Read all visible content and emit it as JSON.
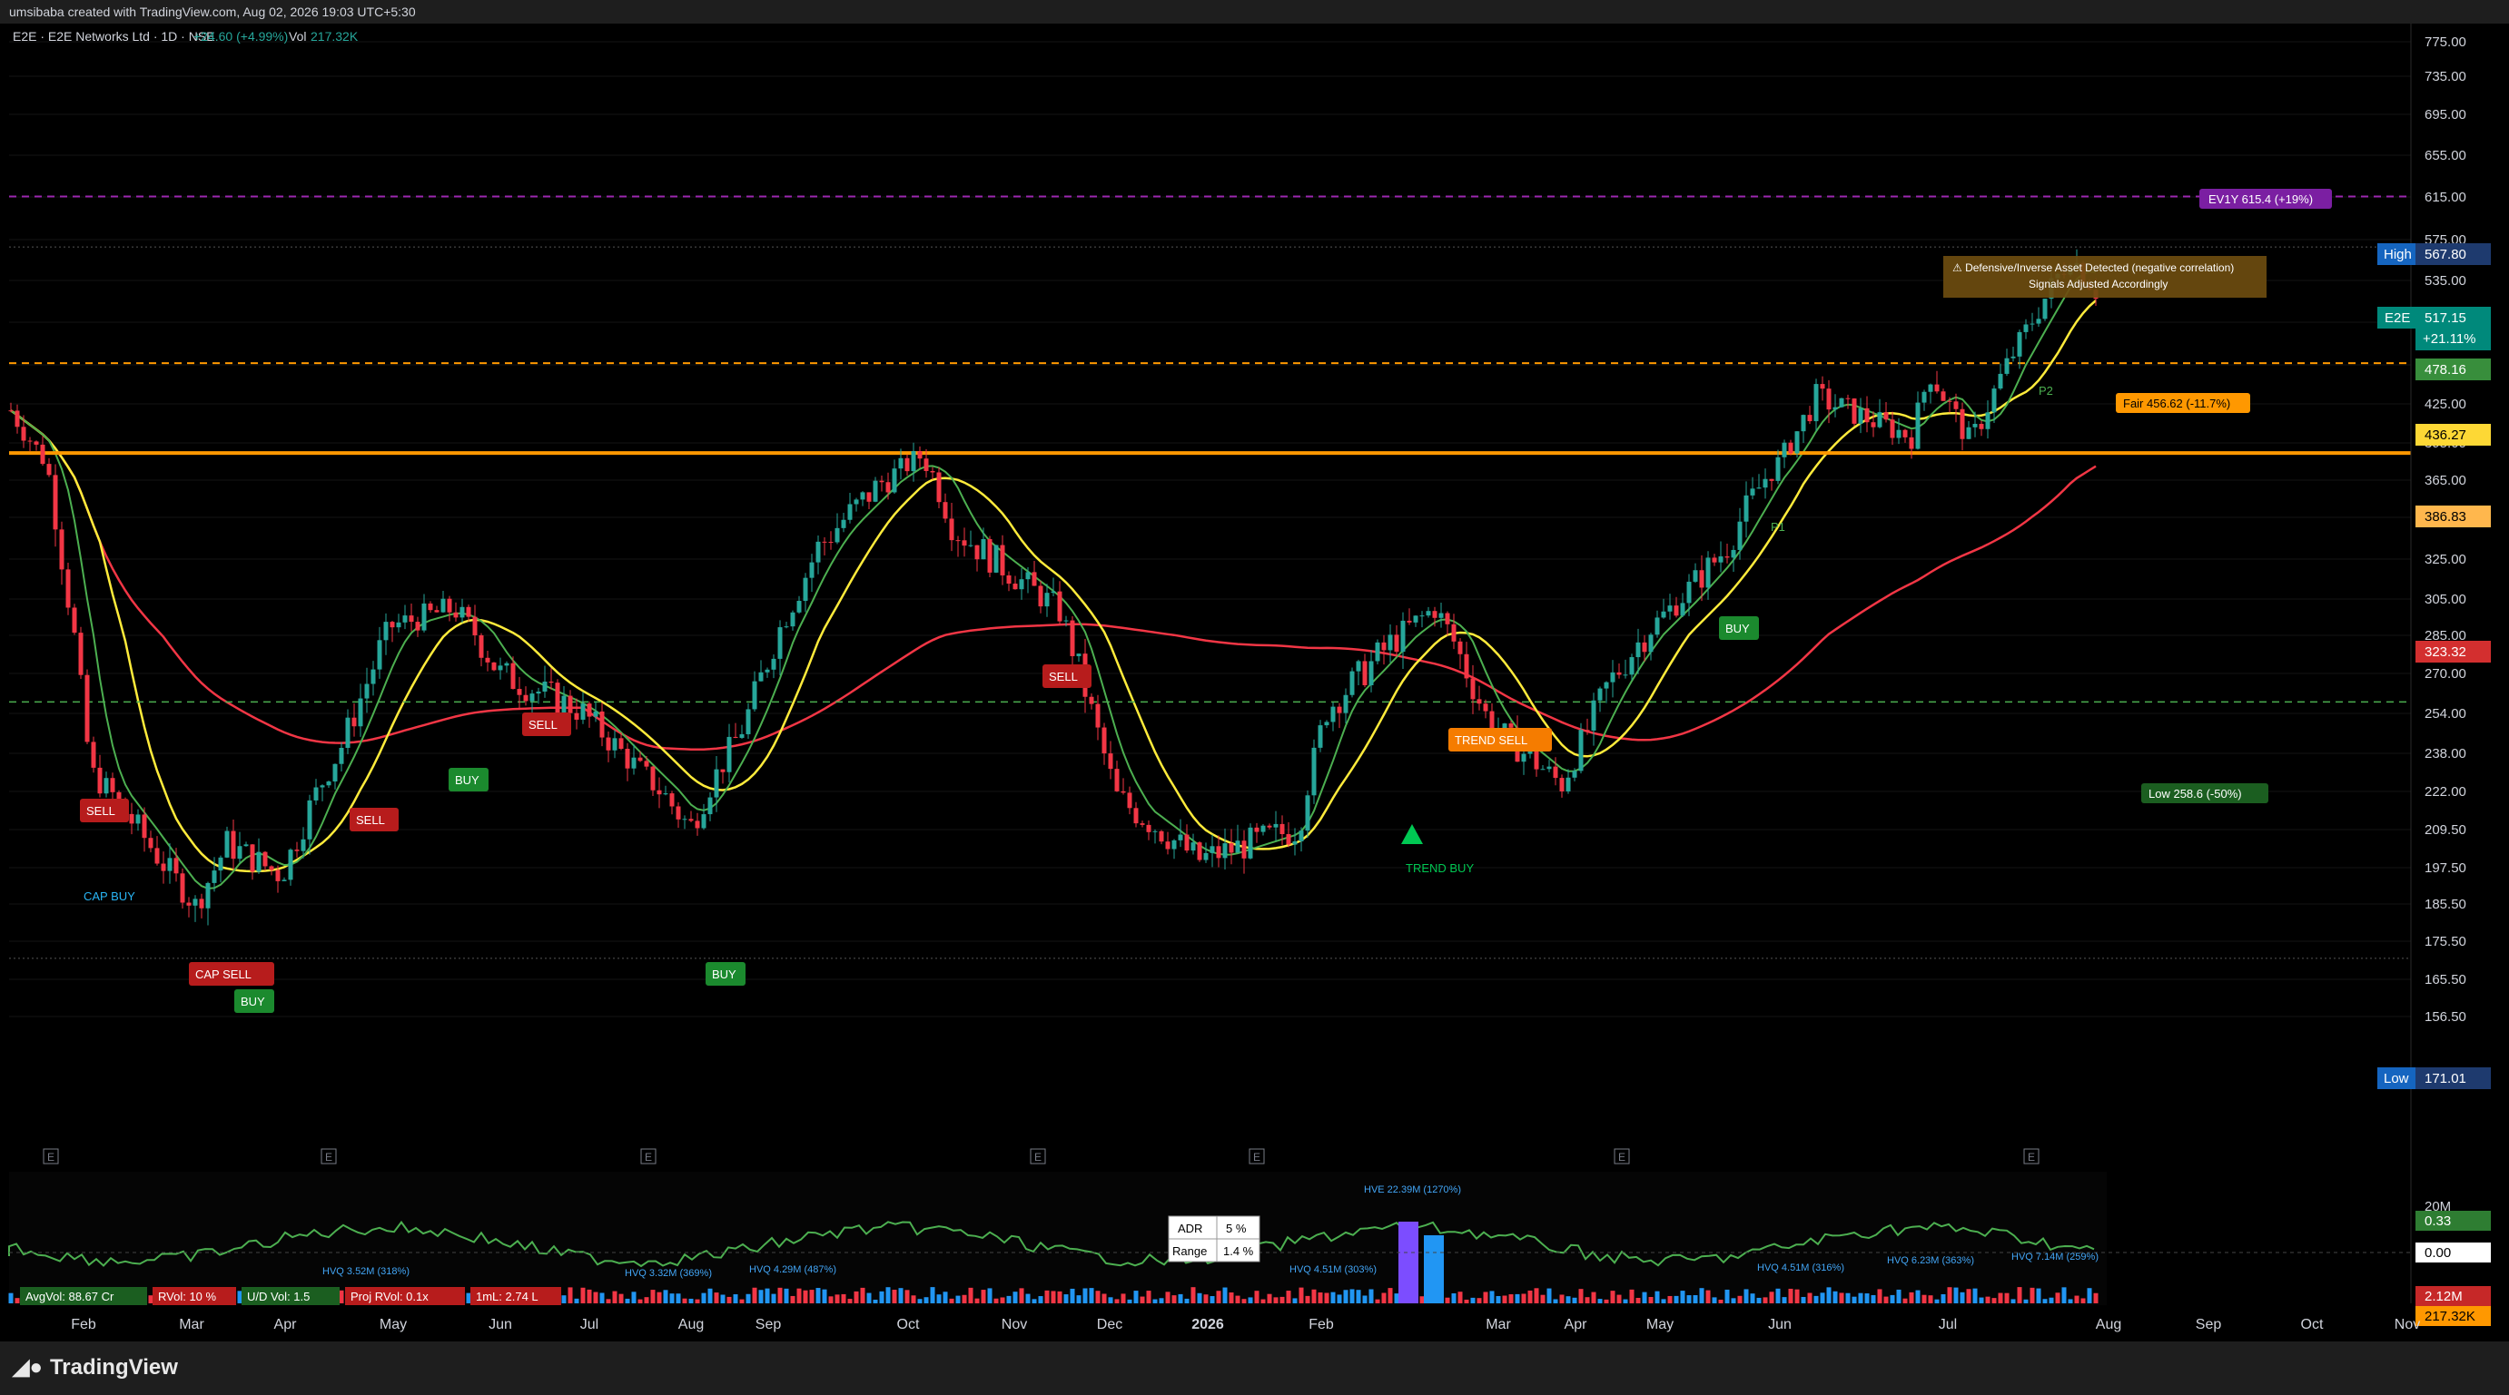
{
  "header": {
    "credit": "umsibaba created with TradingView.com, Aug 02, 2026 19:03 UTC+5:30",
    "symbol": "E2E · E2E Networks Ltd · 1D · NSE",
    "change": "+24.60 (+4.99%)",
    "vol_label": "Vol",
    "vol_value": "217.32K"
  },
  "brand": "TradingView",
  "colors": {
    "background": "#000000",
    "up": "#26a69a",
    "down": "#f23645",
    "sma_fast": "#4caf50",
    "sma_mid": "#ffeb3b",
    "sma_slow": "#f23645",
    "support": "#ff9800",
    "fair": "#ff9800",
    "ev": "#9c27b0"
  },
  "chart_data": {
    "type": "candlestick",
    "ylim": [
      150,
      790
    ],
    "y_ticks": [
      "775.00",
      "735.00",
      "695.00",
      "655.00",
      "615.00",
      "575.00",
      "535.00",
      "495.00",
      "455.00",
      "425.00",
      "395.00",
      "365.00",
      "345.00",
      "325.00",
      "305.00",
      "285.00",
      "270.00",
      "254.00",
      "238.00",
      "222.00",
      "209.50",
      "197.50",
      "185.50",
      "175.50",
      "165.50",
      "156.50"
    ],
    "x_labels": [
      "Feb",
      "Mar",
      "Apr",
      "May",
      "Jun",
      "Jul",
      "Aug",
      "Sep",
      "Oct",
      "Nov",
      "Dec",
      "2026",
      "Feb",
      "Mar",
      "Apr",
      "May",
      "Jun",
      "Jul",
      "Aug",
      "Sep",
      "Oct",
      "Nov"
    ],
    "close_path": [
      [
        "Jan 2025",
        420
      ],
      [
        "Jan end",
        380
      ],
      [
        "Feb mid",
        230
      ],
      [
        "Mar mid",
        185
      ],
      [
        "Mar end",
        205
      ],
      [
        "Apr mid",
        195
      ],
      [
        "Apr end",
        240
      ],
      [
        "May mid",
        290
      ],
      [
        "May end",
        300
      ],
      [
        "Jun mid",
        270
      ],
      [
        "Jul mid",
        255
      ],
      [
        "Aug mid",
        210
      ],
      [
        "Aug end",
        250
      ],
      [
        "Sep mid",
        330
      ],
      [
        "Oct start",
        385
      ],
      [
        "Oct mid",
        340
      ],
      [
        "Nov mid",
        300
      ],
      [
        "Dec start",
        220
      ],
      [
        "Dec mid",
        200
      ],
      [
        "Jan 2026",
        210
      ],
      [
        "Feb 2026",
        255
      ],
      [
        "Feb mid",
        300
      ],
      [
        "Mar start",
        250
      ],
      [
        "Mar end",
        225
      ],
      [
        "Apr",
        265
      ],
      [
        "Apr end",
        330
      ],
      [
        "May mid",
        380
      ],
      [
        "Jun",
        430
      ],
      [
        "Jun end",
        400
      ],
      [
        "Jul start",
        450
      ],
      [
        "Jul mid",
        395
      ],
      [
        "Aug start",
        560
      ],
      [
        "Aug 02",
        517.15
      ]
    ],
    "price_labels": {
      "high": {
        "label": "High",
        "value": "567.80"
      },
      "low": {
        "label": "Low",
        "value": "171.01"
      },
      "last_symbol": "E2E",
      "last": "517.15",
      "last_change": "+21.11%",
      "sma_fast_value": "478.16",
      "sma_mid_value": "436.27",
      "support_value": "386.83",
      "sma_slow_value": "323.32"
    },
    "levels": {
      "ev": {
        "value": 615.4,
        "label": "EV1Y 615.4 (+19%)"
      },
      "fair": {
        "value": 456.62,
        "label": "Fair 456.62 (-11.7%)"
      },
      "low_target": {
        "value": 258.6,
        "label": "Low 258.6 (-50%)"
      },
      "support": {
        "value": 386.83
      }
    },
    "signals": [
      {
        "text": "SELL",
        "kind": "sell"
      },
      {
        "text": "CAP SELL",
        "kind": "sell"
      },
      {
        "text": "SELL",
        "kind": "sell"
      },
      {
        "text": "BUY",
        "kind": "buy"
      },
      {
        "text": "BUY",
        "kind": "buy"
      },
      {
        "text": "SELL",
        "kind": "sell"
      },
      {
        "text": "BUY",
        "kind": "buy"
      },
      {
        "text": "SELL",
        "kind": "sell"
      },
      {
        "text": "TREND SELL",
        "kind": "trend-sell"
      },
      {
        "text": "TREND BUY",
        "kind": "trend-buy"
      },
      {
        "text": "BUY",
        "kind": "buy"
      },
      {
        "text": "CAP BUY",
        "kind": "cap-buy"
      },
      {
        "text": "P1",
        "kind": "note"
      },
      {
        "text": "P2",
        "kind": "note"
      }
    ],
    "alert": {
      "line1": "⚠ Defensive/Inverse Asset Detected (negative correlation)",
      "line2": "Signals Adjusted Accordingly"
    }
  },
  "indicator": {
    "adr_label": "ADR",
    "adr_value": "5 %",
    "range_label": "Range",
    "range_value": "1.4 %",
    "pills": [
      {
        "text": "AvgVol: 88.67 Cr",
        "color": "#1b5e20"
      },
      {
        "text": "RVol: 10 %",
        "color": "#b71c1c"
      },
      {
        "text": "U/D Vol: 1.5",
        "color": "#1b5e20"
      },
      {
        "text": "Proj RVol: 0.1x",
        "color": "#b71c1c"
      },
      {
        "text": "1mL: 2.74 L",
        "color": "#b71c1c"
      }
    ],
    "hvq_labels": [
      "HVQ 3.52M (318%)",
      "HVQ 3.32M (369%)",
      "HVQ 4.29M (487%)",
      "HVQ 4.51M (303%)",
      "HVE 22.39M (1270%)",
      "HVQ 4.51M (316%)",
      "HVQ 6.23M (363%)",
      "HVQ 7.14M (259%)"
    ],
    "axis": {
      "v20m": "20M",
      "green": "0.33",
      "zero": "0.00",
      "red": "2.12M",
      "orange": "217.32K"
    }
  }
}
